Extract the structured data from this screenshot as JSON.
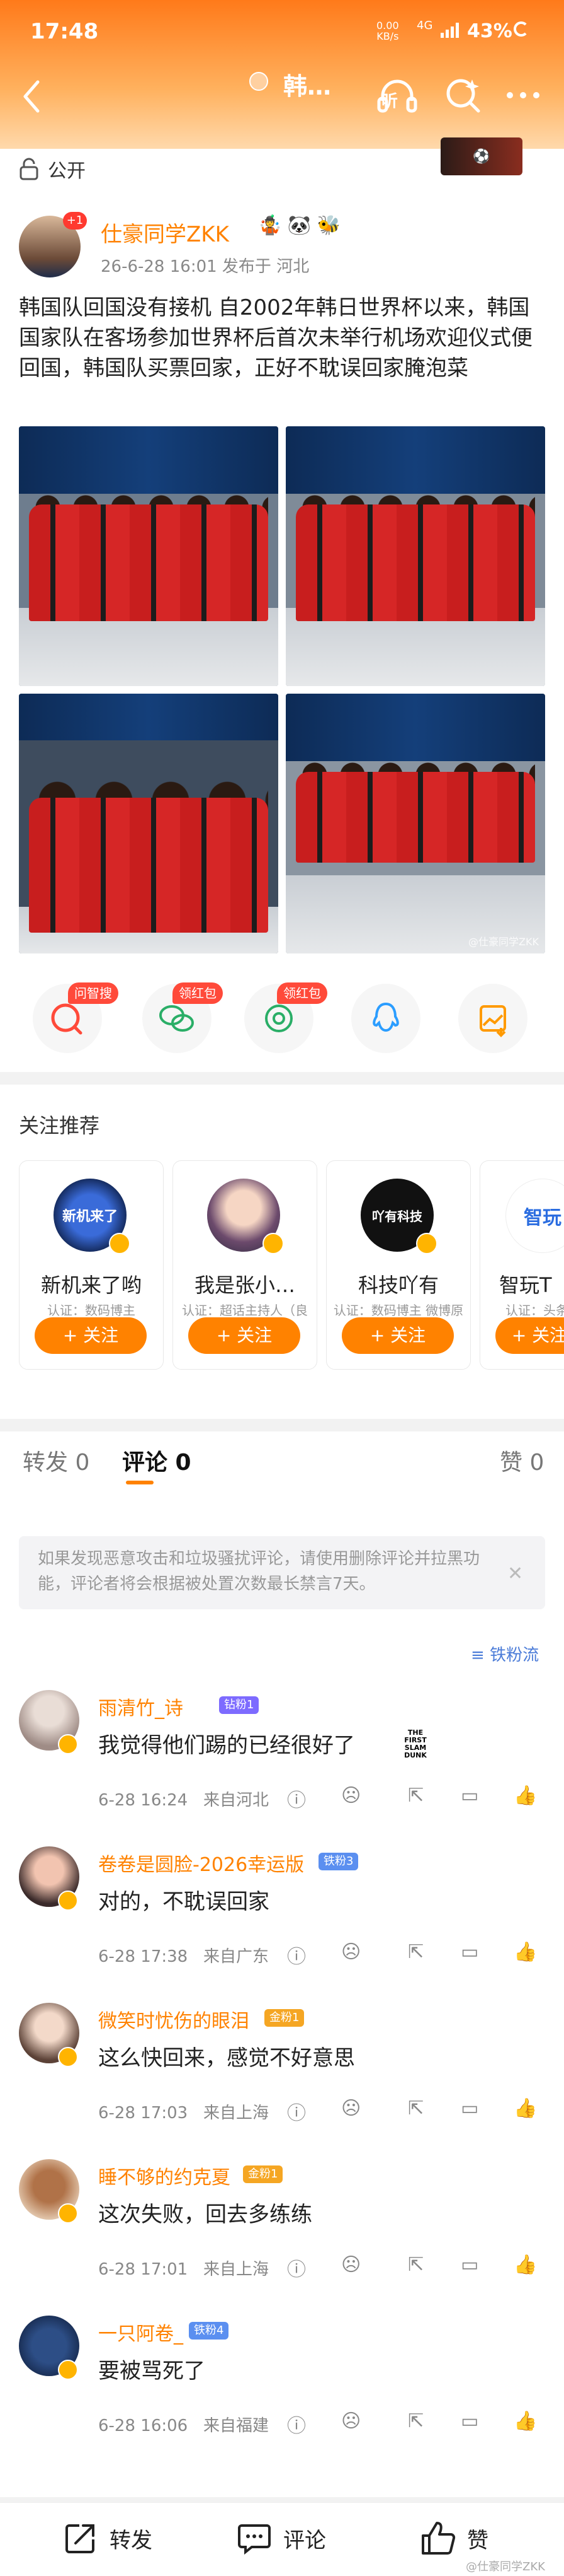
{
  "status_bar": {
    "time": "17:48",
    "speed_value": "0.00",
    "speed_unit": "KB/s",
    "network": "4G",
    "battery": "43%"
  },
  "header": {
    "title": "韩…",
    "listen_label": "听",
    "gradient_from": "#ff7a1a",
    "gradient_to": "#ffd9ac"
  },
  "visibility": {
    "label": "公开"
  },
  "post": {
    "author": "仕豪同学ZKK",
    "avatar_badge": "+1",
    "author_emojis": "🤹 🐼 🐝",
    "meta": "26-6-28 16:01  发布于 河北",
    "text": "韩国队回国没有接机  自2002年韩日世界杯以来，韩国国家队在客场参加世界杯后首次未举行机场欢迎仪式便回国，韩国队买票回家，正好不耽误回家腌泡菜",
    "image_watermark": "@仕豪同学ZKK"
  },
  "share_tags": {
    "wenzhi": "问智搜",
    "red1": "领红包",
    "red2": "领红包"
  },
  "recommend": {
    "title": "关注推荐",
    "follow_label": "+ 关注",
    "cards": [
      {
        "name": "新机来了哟",
        "desc": "认证：数码博主",
        "avatar_text": "新机来了"
      },
      {
        "name": "我是张小…",
        "desc": "认证：超话主持人（良叔的搞…",
        "avatar_text": ""
      },
      {
        "name": "科技吖有",
        "desc": "认证：数码博主 微博原创视频…",
        "avatar_text": "吖有科技"
      },
      {
        "name": "智玩T",
        "desc": "认证：头条文章",
        "avatar_text": "智玩"
      }
    ]
  },
  "tabs": {
    "repost": "转发 0",
    "comment": "评论 0",
    "like": "赞 0"
  },
  "notice": {
    "text": "如果发现恶意攻击和垃圾骚扰评论，请使用删除评论并拉黑功能，评论者将会根据被处置次数最长禁言7天。"
  },
  "fan_label": "铁粉流",
  "comments": [
    {
      "name": "雨清竹_诗",
      "badge": "钻粉1",
      "text": "我觉得他们踢的已经很好了",
      "time": "6-28 16:24",
      "loc": "来自河北",
      "sticker": "THE FIRST SLAM DUNK"
    },
    {
      "name": "卷卷是圆脸-2026幸运版",
      "badge": "铁粉3",
      "text": "对的，不耽误回家",
      "time": "6-28 17:38",
      "loc": "来自广东",
      "sticker": ""
    },
    {
      "name": "微笑时忧伤的眼泪",
      "badge": "金粉1",
      "text": "这么快回来，感觉不好意思",
      "time": "6-28 17:03",
      "loc": "来自上海",
      "sticker": ""
    },
    {
      "name": "睡不够的约克夏",
      "badge": "金粉1",
      "text": "这次失败，回去多练练",
      "time": "6-28 17:01",
      "loc": "来自上海",
      "sticker": ""
    },
    {
      "name": "一只阿卷_",
      "badge": "铁粉4",
      "text": "要被骂死了",
      "time": "6-28 16:06",
      "loc": "来自福建",
      "sticker": ""
    }
  ],
  "bottom_bar": {
    "repost": "转发",
    "comment": "评论",
    "like": "赞"
  },
  "page_watermark": "@仕豪同学ZKK",
  "accent_color": "#ff8200"
}
